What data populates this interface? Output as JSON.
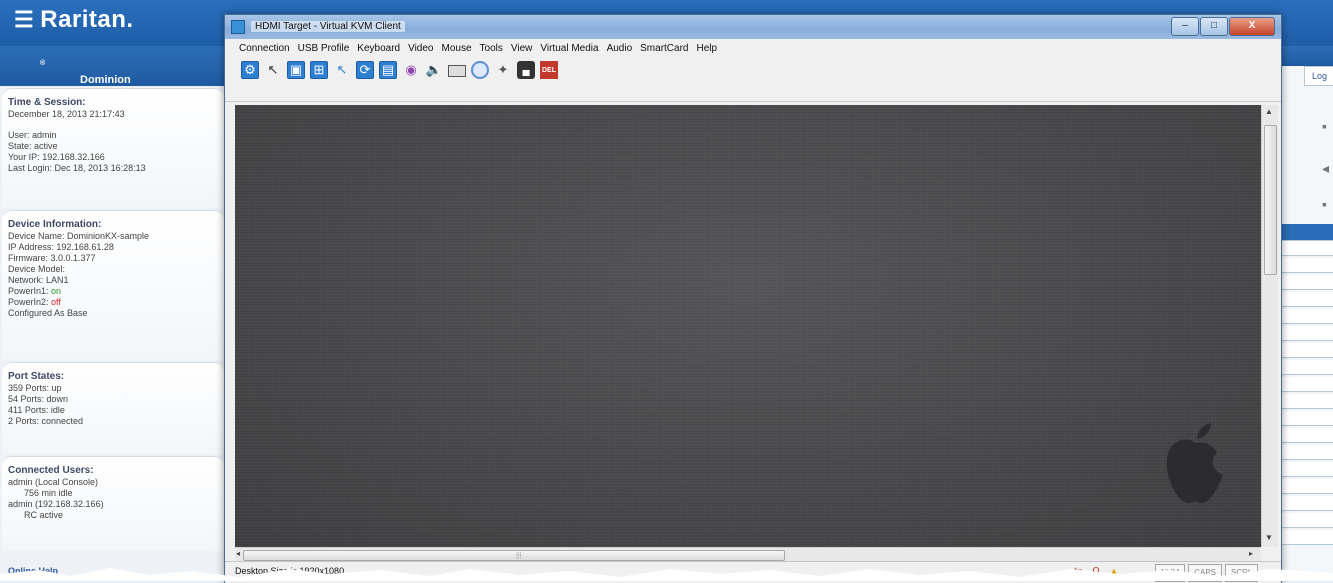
{
  "background_app": {
    "brand": "Raritan.",
    "product": "Dominion",
    "product_mark": "®",
    "time_session": {
      "title": "Time & Session:",
      "datetime": "December 18, 2013 21:17:43",
      "user": "User: admin",
      "state": "State: active",
      "your_ip": "Your IP: 192.168.32.166",
      "last_login": "Last Login: Dec 18, 2013 16:28:13"
    },
    "device_info": {
      "title": "Device Information:",
      "device_name": "Device Name: DominionKX-sample",
      "ip_address": "IP Address: 192.168.61.28",
      "firmware": "Firmware: 3.0.0.1.377",
      "device_model": "Device Model:",
      "network": "Network: LAN1",
      "powerin1_label": "PowerIn1: ",
      "powerin1_value": "on",
      "powerin2_label": "PowerIn2: ",
      "powerin2_value": "off",
      "configured": "Configured As Base"
    },
    "port_states": {
      "title": "Port States:",
      "lines": [
        "359 Ports: up",
        "54 Ports: down",
        "411 Ports: idle",
        "2 Ports: connected"
      ]
    },
    "connected_users": {
      "title": "Connected Users:",
      "lines": [
        "admin (Local Console)",
        "756 min idle",
        "admin (192.168.32.166)",
        "RC active"
      ]
    },
    "online_help": "Online Help",
    "right_tab": "Log"
  },
  "kvm_window": {
    "title": "HDMI Target - Virtual KVM Client",
    "controls": {
      "minimize": "–",
      "maximize": "□",
      "close": "X"
    },
    "menu": [
      "Connection",
      "USB Profile",
      "Keyboard",
      "Video",
      "Mouse",
      "Tools",
      "View",
      "Virtual Media",
      "Audio",
      "SmartCard",
      "Help"
    ],
    "toolbar": [
      {
        "icon": "connection-properties-icon",
        "glyph": "⚙"
      },
      {
        "icon": "single-cursor-icon",
        "glyph": "↖"
      },
      {
        "icon": "full-screen-icon",
        "glyph": "▣"
      },
      {
        "icon": "scaling-icon",
        "glyph": "⊞"
      },
      {
        "icon": "sync-mouse-icon",
        "glyph": "↖"
      },
      {
        "icon": "refresh-screen-icon",
        "glyph": "⟳"
      },
      {
        "icon": "auto-sense-video-icon",
        "glyph": "▤"
      },
      {
        "icon": "video-settings-icon",
        "glyph": "◉"
      },
      {
        "icon": "audio-icon",
        "glyph": "🔈"
      },
      {
        "icon": "virtual-media-drive-icon",
        "glyph": ""
      },
      {
        "icon": "cd-rom-icon",
        "glyph": ""
      },
      {
        "icon": "smartcard-icon",
        "glyph": "✦"
      },
      {
        "icon": "screenshot-camera-icon",
        "glyph": "▄"
      },
      {
        "icon": "ctrl-alt-del-icon",
        "glyph": "DEL"
      }
    ],
    "status": {
      "text": "Desktop Size is 1920x1080",
      "indicators": [
        "NUM",
        "CAPS",
        "SCRL"
      ]
    }
  }
}
